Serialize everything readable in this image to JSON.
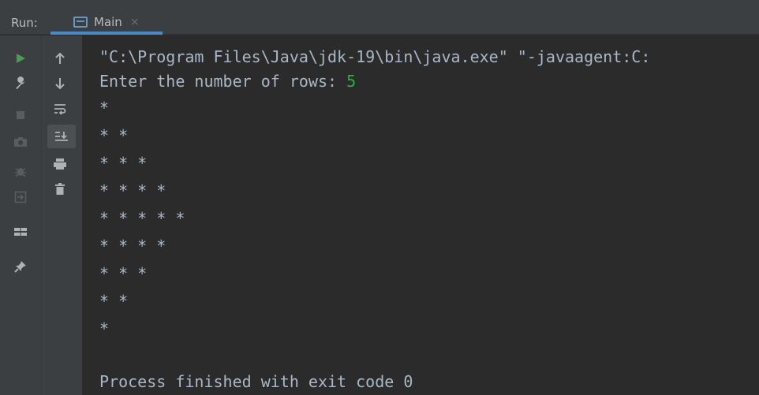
{
  "tabbar": {
    "run_label": "Run:",
    "tab_label": "Main",
    "tab_close": "×"
  },
  "toolbar": {
    "left": [
      {
        "name": "run-icon",
        "color": "#499c54"
      },
      {
        "name": "wrench-icon",
        "color": "#afb1b3"
      },
      {
        "name": "stop-icon",
        "color": "#6e6e6e"
      },
      {
        "name": "camera-icon",
        "color": "#6e6e6e"
      },
      {
        "name": "bug-icon",
        "color": "#6e6e6e"
      },
      {
        "name": "exit-icon",
        "color": "#6e6e6e"
      },
      {
        "name": "layout-icon",
        "color": "#afb1b3"
      },
      {
        "name": "pin-icon",
        "color": "#afb1b3"
      }
    ],
    "right": [
      {
        "name": "arrow-up-icon"
      },
      {
        "name": "arrow-down-icon"
      },
      {
        "name": "soft-wrap-icon"
      },
      {
        "name": "scroll-to-end-icon"
      },
      {
        "name": "print-icon"
      },
      {
        "name": "trash-icon"
      }
    ]
  },
  "console": {
    "command": "\"C:\\Program Files\\Java\\jdk-19\\bin\\java.exe\" \"-javaagent:C:",
    "prompt": "Enter the number of rows: ",
    "input_value": "5",
    "rows": [
      "*",
      "* *",
      "* * *",
      "* * * *",
      "* * * * *",
      "* * * *",
      "* * *",
      "* *",
      "*"
    ],
    "exit_message": "Process finished with exit code 0"
  },
  "colors": {
    "background": "#2b2b2b",
    "text": "#a9b7c6",
    "input": "#2fae3c",
    "accent": "#4a88c7"
  }
}
